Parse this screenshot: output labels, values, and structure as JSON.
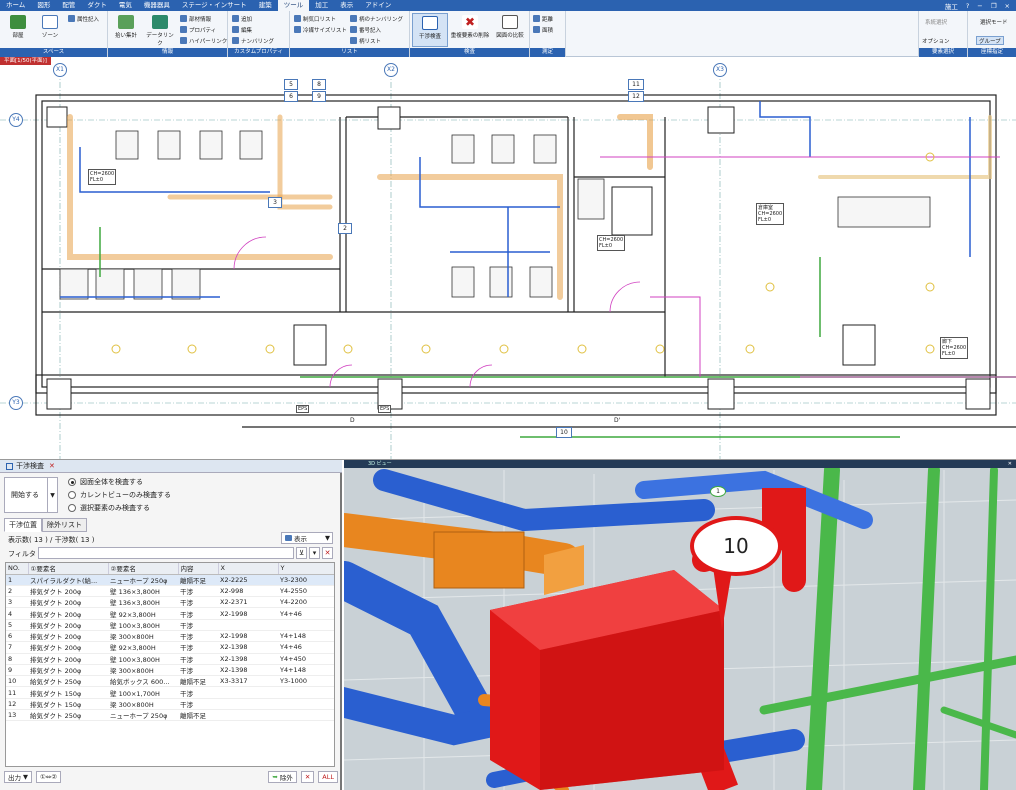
{
  "menubar": {
    "tabs": [
      "ホーム",
      "図形",
      "配管",
      "ダクト",
      "電気",
      "機器器具",
      "ステージ・インサート",
      "建築",
      "ツール",
      "加工",
      "表示",
      "アドイン"
    ],
    "active_tab": "ツール",
    "right_label": "施工"
  },
  "ribbon": {
    "groups": {
      "space": "スペース",
      "info": "情報",
      "custom": "カスタムプロパティ",
      "list": "リスト",
      "check": "検査",
      "measure": "測定",
      "element_select": "要素選択",
      "coord": "座標指定"
    },
    "buttons": {
      "room": "部屋",
      "zone": "ゾーン",
      "attr_entry": "属性記入",
      "simple_tally": "拾い集計",
      "data_link": "データリンク",
      "parts_info": "部材情報",
      "property": "プロパティ",
      "hyperlink": "ハイパーリンク",
      "add": "追加",
      "edit": "編集",
      "numbering": "ナンバリング",
      "control_list": "制気口リスト",
      "coolant_size_list": "冷媒サイズリスト",
      "sleeve_numbering": "柄のナンバリング",
      "number_entry": "番号記入",
      "sleeve_list": "柄リスト",
      "interference_check": "干渉検査",
      "remove_duplicates": "重複要素の削除",
      "compare_drawings": "図面の比較",
      "distance": "距離",
      "area": "面積",
      "system_select": "系統選択",
      "select_mode": "選択モード",
      "option": "オプション",
      "group": "グループ"
    }
  },
  "drawing": {
    "tab_label": "平面[1/50(平面)]",
    "axis_labels": [
      "X1",
      "X2",
      "X3",
      "Y4",
      "Y3"
    ],
    "balloons": [
      "5",
      "6",
      "8",
      "9",
      "3",
      "2",
      "11",
      "12",
      "10"
    ],
    "room_tags": [
      "CH=2600\nFL±0",
      "CH=2600\nFL±0",
      "倉庫室\nCH=2600\nFL±0",
      "廊下\nCH=2600\nFL±0"
    ],
    "small_tags": [
      "EPS",
      "EPS",
      "D",
      "D'"
    ]
  },
  "panel": {
    "title": "干渉検査",
    "start_button": "開始する",
    "radio_options": [
      "図面全体を検査する",
      "カレントビューのみ検査する",
      "選択要素のみ検査する"
    ],
    "radio_selected": 0,
    "tabs": [
      "干渉位置",
      "除外リスト"
    ],
    "active_tab": 0,
    "counts_text": "表示数( 13 ) / 干渉数( 13 )",
    "show_button": "表示",
    "filter_label": "フィルタ",
    "filter_value": "",
    "columns": [
      "NO.",
      "①要素名",
      "②要素名",
      "内容",
      "X",
      "Y"
    ],
    "rows": [
      [
        "1",
        "スパイラルダクト(給...",
        "ニューホープ 250φ",
        "離隔不足",
        "X2-2225",
        "Y3-2300"
      ],
      [
        "2",
        "排気ダクト 200φ",
        "壁 136×3,800H",
        "干渉",
        "X2-998",
        "Y4-2550"
      ],
      [
        "3",
        "排気ダクト 200φ",
        "壁 136×3,800H",
        "干渉",
        "X2-2371",
        "Y4-2200"
      ],
      [
        "4",
        "排気ダクト 200φ",
        "壁 92×3,800H",
        "干渉",
        "X2-1998",
        "Y4+46"
      ],
      [
        "5",
        "排気ダクト 200φ",
        "壁 100×3,800H",
        "干渉",
        "",
        ""
      ],
      [
        "6",
        "排気ダクト 200φ",
        "梁 300×800H",
        "干渉",
        "X2-1998",
        "Y4+148"
      ],
      [
        "7",
        "排気ダクト 200φ",
        "壁 92×3,800H",
        "干渉",
        "X2-1398",
        "Y4+46"
      ],
      [
        "8",
        "排気ダクト 200φ",
        "壁 100×3,800H",
        "干渉",
        "X2-1398",
        "Y4+450"
      ],
      [
        "9",
        "排気ダクト 200φ",
        "梁 300×800H",
        "干渉",
        "X2-1398",
        "Y4+148"
      ],
      [
        "10",
        "給気ダクト 250φ",
        "給気ボックス 600...",
        "離隔不足",
        "X3-3317",
        "Y3-1000"
      ],
      [
        "11",
        "排気ダクト 150φ",
        "壁 100×1,700H",
        "干渉",
        "",
        ""
      ],
      [
        "12",
        "排気ダクト 150φ",
        "梁 300×800H",
        "干渉",
        "",
        ""
      ],
      [
        "13",
        "給気ダクト 250φ",
        "ニューホープ 250φ",
        "離隔不足",
        "",
        ""
      ]
    ],
    "footer": {
      "output": "出力",
      "swap": "①⇔②",
      "exclude": "除外",
      "all": "ALL"
    }
  },
  "view3d": {
    "title": "3D ビュー",
    "balloon_main": "10",
    "balloon_small": "1"
  },
  "colors": {
    "accent": "#2b62b0",
    "duct_blue": "#2a5fd0",
    "duct_orange": "#e8861f",
    "pipe_green": "#3fa83f",
    "clash_red": "#e01818"
  }
}
